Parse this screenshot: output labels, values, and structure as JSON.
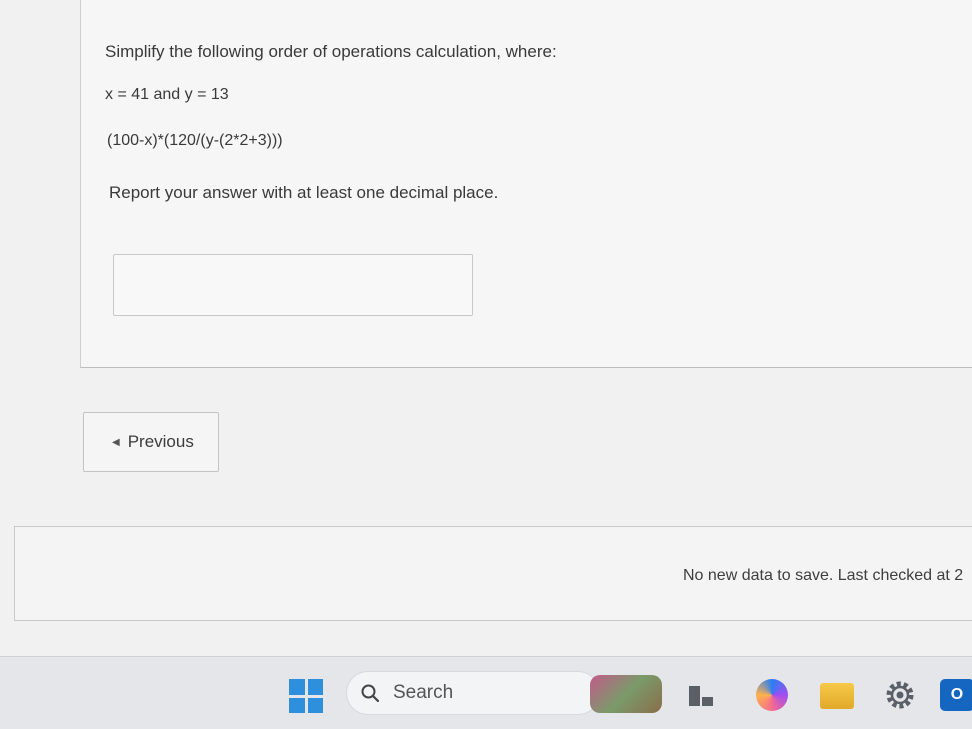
{
  "question": {
    "prompt": "Simplify the following order of operations calculation, where:",
    "variables": "x = 41 and y = 13",
    "expression": "(100-x)*(120/(y-(2*2+3)))",
    "instructions": "Report your answer with at least one decimal place.",
    "answer_value": "",
    "answer_placeholder": ""
  },
  "navigation": {
    "previous_label": "Previous",
    "previous_icon": "chevron-left-icon"
  },
  "status": {
    "text": "No new data to save. Last checked at 2"
  },
  "taskbar": {
    "search_label": "Search",
    "icons": [
      "windows-start-icon",
      "search-icon",
      "widgets-icon",
      "task-view-icon",
      "copilot-icon",
      "file-explorer-icon",
      "settings-icon",
      "outlook-icon"
    ],
    "outlook_letter": "O",
    "accent_color": "#2e8fdc"
  }
}
